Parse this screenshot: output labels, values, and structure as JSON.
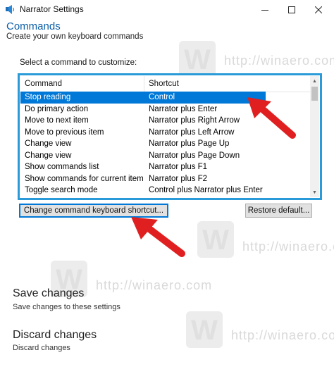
{
  "window": {
    "title": "Narrator Settings",
    "icon": "narrator-icon",
    "controls": {
      "minimize": "minimize-icon",
      "maximize": "maximize-icon",
      "close": "close-icon"
    }
  },
  "page": {
    "heading": "Commands",
    "subheading": "Create your own keyboard commands",
    "select_label": "Select a command to customize:"
  },
  "command_list": {
    "columns": [
      "Command",
      "Shortcut"
    ],
    "selected_index": 0,
    "rows": [
      {
        "command": "Stop reading",
        "shortcut": "Control"
      },
      {
        "command": "Do primary action",
        "shortcut": "Narrator plus Enter"
      },
      {
        "command": "Move to next item",
        "shortcut": "Narrator plus Right Arrow"
      },
      {
        "command": "Move to previous item",
        "shortcut": "Narrator plus Left Arrow"
      },
      {
        "command": "Change view",
        "shortcut": "Narrator plus Page Up"
      },
      {
        "command": "Change view",
        "shortcut": "Narrator plus Page Down"
      },
      {
        "command": "Show commands list",
        "shortcut": "Narrator plus F1"
      },
      {
        "command": "Show commands for current item",
        "shortcut": "Narrator plus F2"
      },
      {
        "command": "Toggle search mode",
        "shortcut": "Control plus Narrator plus Enter"
      }
    ]
  },
  "buttons": {
    "change_shortcut": "Change command keyboard shortcut...",
    "restore_default": "Restore default..."
  },
  "actions": {
    "save_title": "Save changes",
    "save_desc": "Save changes to these settings",
    "discard_title": "Discard changes",
    "discard_desc": "Discard changes"
  },
  "watermark": {
    "text": "http://winaero.com",
    "logo_letter": "W"
  },
  "colors": {
    "accent": "#0078d7",
    "heading": "#0d5fa8",
    "list_border": "#2a9bd8",
    "annotation_arrow": "#e02020",
    "watermark": "#d9d9d9"
  }
}
